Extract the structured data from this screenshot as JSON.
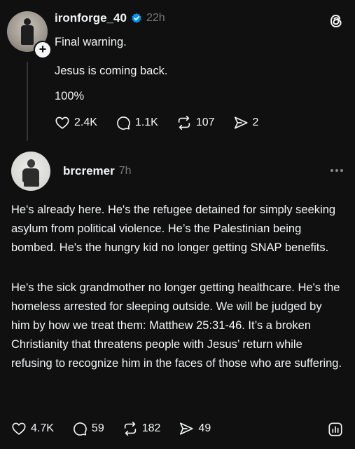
{
  "post1": {
    "username": "ironforge_40",
    "time": "22h",
    "lines": [
      "Final warning.",
      "Jesus is coming back.",
      "100%"
    ],
    "actions": {
      "likes": "2.4K",
      "replies": "1.1K",
      "reposts": "107",
      "shares": "2"
    }
  },
  "post2": {
    "username": "brcremer",
    "time": "7h",
    "para1": "He's already here. He's the refugee detained for simply seeking asylum from political violence. He’s the Palestinian being bombed. He's the hungry kid no longer getting SNAP benefits.",
    "para2": "He's the sick grandmother no longer getting healthcare. He's the homeless arrested for sleeping outside. We will be judged by him by how we treat them: Matthew 25:31-46. It’s a broken Christianity that threatens people with Jesus’ return while refusing to recognize him in the faces of those who are suffering.",
    "actions": {
      "likes": "4.7K",
      "replies": "59",
      "reposts": "182",
      "shares": "49"
    }
  },
  "icons": {
    "verified": "verified-badge-icon",
    "logo": "threads-logo-icon",
    "like": "heart-icon",
    "reply": "comment-icon",
    "repost": "repost-icon",
    "share": "share-icon",
    "more": "more-dots-icon",
    "insights": "insights-icon"
  },
  "colors": {
    "background": "#101010",
    "text": "#f3f5f7",
    "muted": "#77777b",
    "verified": "#0095f6"
  }
}
